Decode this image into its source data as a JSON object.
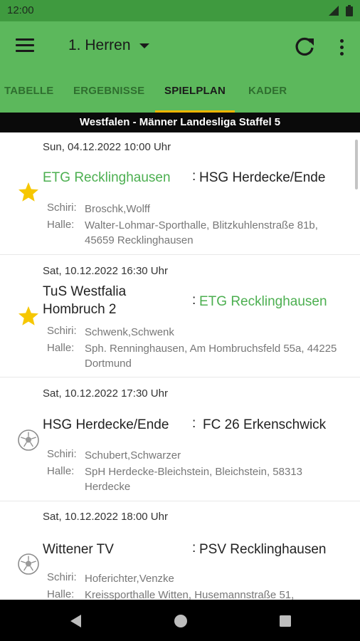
{
  "status": {
    "time": "12:00"
  },
  "appbar": {
    "team": "1. Herren"
  },
  "tabs": [
    {
      "label": "TABELLE"
    },
    {
      "label": "ERGEBNISSE"
    },
    {
      "label": "SPIELPLAN"
    },
    {
      "label": "KADER"
    }
  ],
  "active_tab": "SPIELPLAN",
  "league": "Westfalen - Männer Landesliga Staffel 5",
  "labels": {
    "schiri": "Schiri:",
    "halle": "Halle:",
    "sep": ":"
  },
  "matches": [
    {
      "date": "Sun, 04.12.2022 10:00 Uhr",
      "home": "ETG Recklinghausen",
      "away": "HSG Herdecke/Ende",
      "schiri": "Broschk,Wolff",
      "halle": "Walter-Lohmar-Sporthalle, Blitzkuhlenstraße 81b, 45659 Recklinghausen",
      "icon": "star-icon"
    },
    {
      "date": "Sat, 10.12.2022 16:30 Uhr",
      "home": "TuS Westfalia Hombruch 2",
      "away": "ETG Recklinghausen",
      "schiri": "Schwenk,Schwenk",
      "halle": "Sph. Renninghausen, Am Hombruchsfeld 55a, 44225 Dortmund",
      "icon": "star-icon"
    },
    {
      "date": "Sat, 10.12.2022 17:30 Uhr",
      "home": "HSG Herdecke/Ende",
      "away": "FC 26 Erkenschwick",
      "schiri": "Schubert,Schwarzer",
      "halle": "SpH Herdecke-Bleichstein, Bleichstein, 58313 Herdecke",
      "icon": "ball-icon"
    },
    {
      "date": "Sat, 10.12.2022 18:00 Uhr",
      "home": "Wittener TV",
      "away": "PSV Recklinghausen",
      "schiri": "Hoferichter,Venzke",
      "halle": "Kreissporthalle Witten, Husemannstraße 51,",
      "icon": "ball-icon"
    }
  ],
  "colors": {
    "primary": "#5cb85c",
    "status": "#3f9a3f",
    "favorite": "#4caf50",
    "star": "#f6c700",
    "indicator": "#f4b400"
  }
}
